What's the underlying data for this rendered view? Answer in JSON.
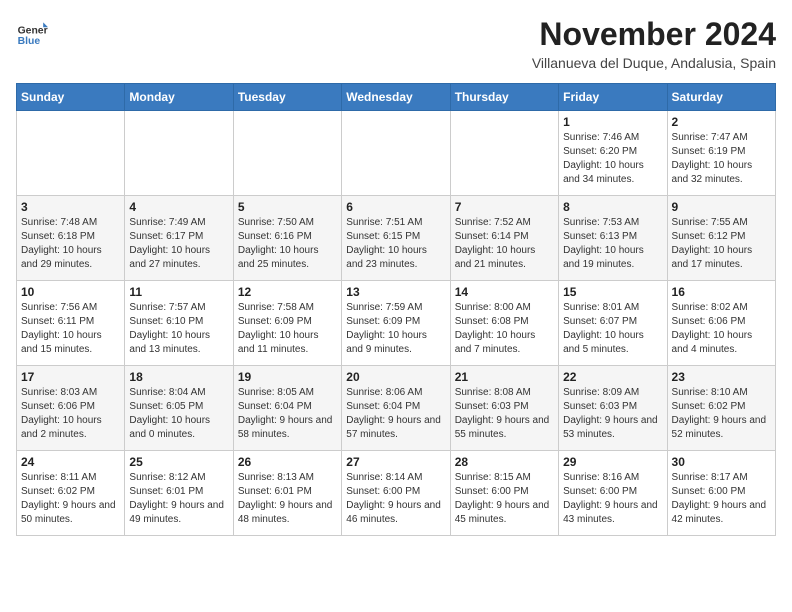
{
  "header": {
    "logo_line1": "General",
    "logo_line2": "Blue",
    "month_year": "November 2024",
    "location": "Villanueva del Duque, Andalusia, Spain"
  },
  "weekdays": [
    "Sunday",
    "Monday",
    "Tuesday",
    "Wednesday",
    "Thursday",
    "Friday",
    "Saturday"
  ],
  "weeks": [
    [
      {
        "day": "",
        "info": ""
      },
      {
        "day": "",
        "info": ""
      },
      {
        "day": "",
        "info": ""
      },
      {
        "day": "",
        "info": ""
      },
      {
        "day": "",
        "info": ""
      },
      {
        "day": "1",
        "info": "Sunrise: 7:46 AM\nSunset: 6:20 PM\nDaylight: 10 hours and 34 minutes."
      },
      {
        "day": "2",
        "info": "Sunrise: 7:47 AM\nSunset: 6:19 PM\nDaylight: 10 hours and 32 minutes."
      }
    ],
    [
      {
        "day": "3",
        "info": "Sunrise: 7:48 AM\nSunset: 6:18 PM\nDaylight: 10 hours and 29 minutes."
      },
      {
        "day": "4",
        "info": "Sunrise: 7:49 AM\nSunset: 6:17 PM\nDaylight: 10 hours and 27 minutes."
      },
      {
        "day": "5",
        "info": "Sunrise: 7:50 AM\nSunset: 6:16 PM\nDaylight: 10 hours and 25 minutes."
      },
      {
        "day": "6",
        "info": "Sunrise: 7:51 AM\nSunset: 6:15 PM\nDaylight: 10 hours and 23 minutes."
      },
      {
        "day": "7",
        "info": "Sunrise: 7:52 AM\nSunset: 6:14 PM\nDaylight: 10 hours and 21 minutes."
      },
      {
        "day": "8",
        "info": "Sunrise: 7:53 AM\nSunset: 6:13 PM\nDaylight: 10 hours and 19 minutes."
      },
      {
        "day": "9",
        "info": "Sunrise: 7:55 AM\nSunset: 6:12 PM\nDaylight: 10 hours and 17 minutes."
      }
    ],
    [
      {
        "day": "10",
        "info": "Sunrise: 7:56 AM\nSunset: 6:11 PM\nDaylight: 10 hours and 15 minutes."
      },
      {
        "day": "11",
        "info": "Sunrise: 7:57 AM\nSunset: 6:10 PM\nDaylight: 10 hours and 13 minutes."
      },
      {
        "day": "12",
        "info": "Sunrise: 7:58 AM\nSunset: 6:09 PM\nDaylight: 10 hours and 11 minutes."
      },
      {
        "day": "13",
        "info": "Sunrise: 7:59 AM\nSunset: 6:09 PM\nDaylight: 10 hours and 9 minutes."
      },
      {
        "day": "14",
        "info": "Sunrise: 8:00 AM\nSunset: 6:08 PM\nDaylight: 10 hours and 7 minutes."
      },
      {
        "day": "15",
        "info": "Sunrise: 8:01 AM\nSunset: 6:07 PM\nDaylight: 10 hours and 5 minutes."
      },
      {
        "day": "16",
        "info": "Sunrise: 8:02 AM\nSunset: 6:06 PM\nDaylight: 10 hours and 4 minutes."
      }
    ],
    [
      {
        "day": "17",
        "info": "Sunrise: 8:03 AM\nSunset: 6:06 PM\nDaylight: 10 hours and 2 minutes."
      },
      {
        "day": "18",
        "info": "Sunrise: 8:04 AM\nSunset: 6:05 PM\nDaylight: 10 hours and 0 minutes."
      },
      {
        "day": "19",
        "info": "Sunrise: 8:05 AM\nSunset: 6:04 PM\nDaylight: 9 hours and 58 minutes."
      },
      {
        "day": "20",
        "info": "Sunrise: 8:06 AM\nSunset: 6:04 PM\nDaylight: 9 hours and 57 minutes."
      },
      {
        "day": "21",
        "info": "Sunrise: 8:08 AM\nSunset: 6:03 PM\nDaylight: 9 hours and 55 minutes."
      },
      {
        "day": "22",
        "info": "Sunrise: 8:09 AM\nSunset: 6:03 PM\nDaylight: 9 hours and 53 minutes."
      },
      {
        "day": "23",
        "info": "Sunrise: 8:10 AM\nSunset: 6:02 PM\nDaylight: 9 hours and 52 minutes."
      }
    ],
    [
      {
        "day": "24",
        "info": "Sunrise: 8:11 AM\nSunset: 6:02 PM\nDaylight: 9 hours and 50 minutes."
      },
      {
        "day": "25",
        "info": "Sunrise: 8:12 AM\nSunset: 6:01 PM\nDaylight: 9 hours and 49 minutes."
      },
      {
        "day": "26",
        "info": "Sunrise: 8:13 AM\nSunset: 6:01 PM\nDaylight: 9 hours and 48 minutes."
      },
      {
        "day": "27",
        "info": "Sunrise: 8:14 AM\nSunset: 6:00 PM\nDaylight: 9 hours and 46 minutes."
      },
      {
        "day": "28",
        "info": "Sunrise: 8:15 AM\nSunset: 6:00 PM\nDaylight: 9 hours and 45 minutes."
      },
      {
        "day": "29",
        "info": "Sunrise: 8:16 AM\nSunset: 6:00 PM\nDaylight: 9 hours and 43 minutes."
      },
      {
        "day": "30",
        "info": "Sunrise: 8:17 AM\nSunset: 6:00 PM\nDaylight: 9 hours and 42 minutes."
      }
    ]
  ]
}
